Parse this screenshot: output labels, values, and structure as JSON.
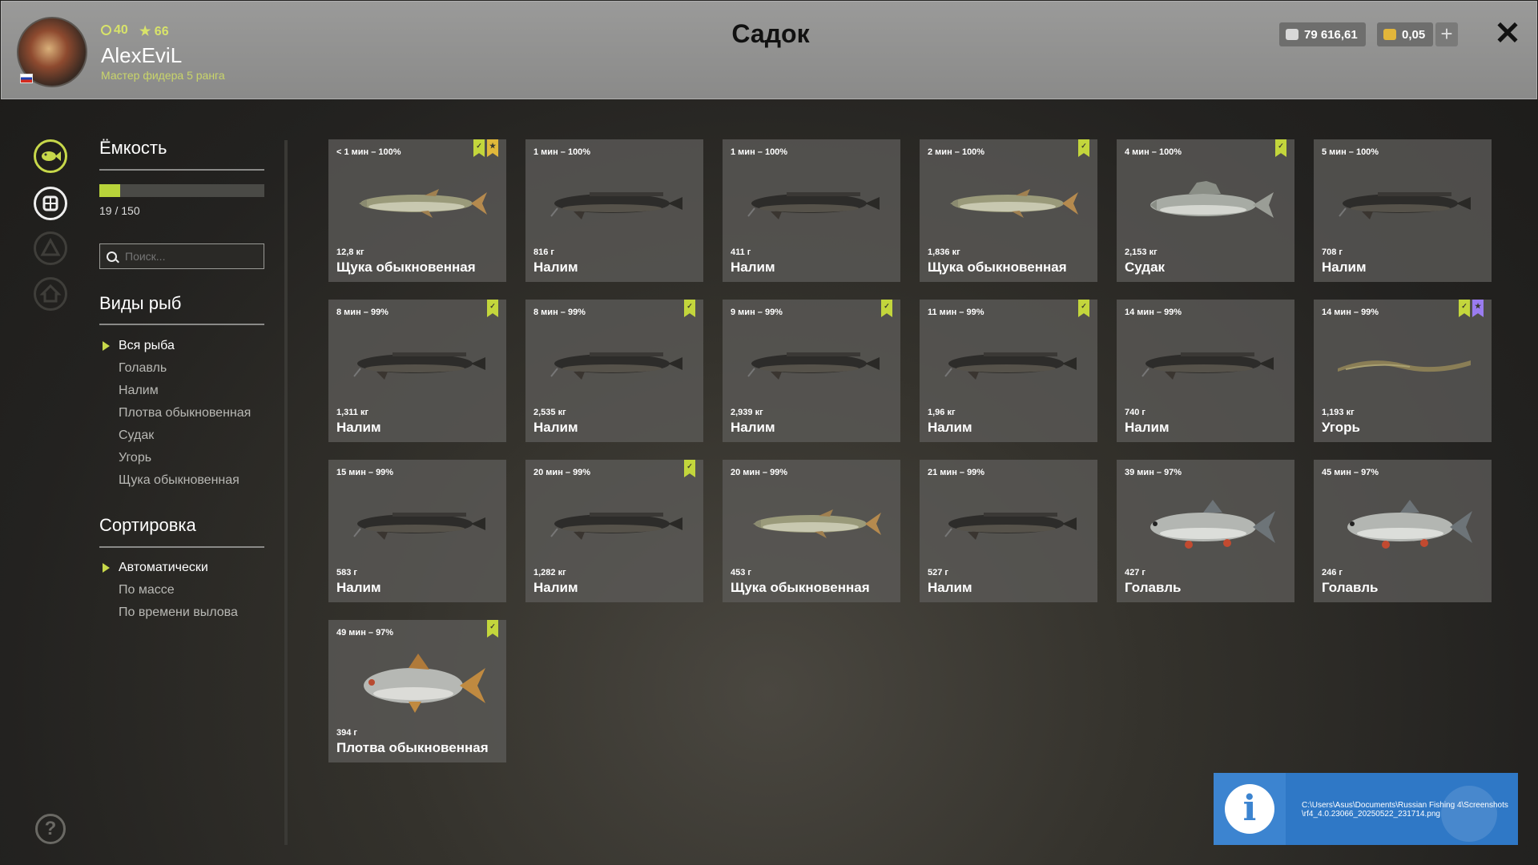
{
  "header": {
    "title": "Садок",
    "username": "AlexEviL",
    "rank": "Мастер фидера 5 ранга",
    "level": "40",
    "stars": "66",
    "silver": "79 616,61",
    "gold": "0,05"
  },
  "capacity": {
    "heading": "Ёмкость",
    "text": "19 / 150",
    "fill_fraction": 0.127
  },
  "search": {
    "placeholder": "Поиск..."
  },
  "species": {
    "heading": "Виды рыб",
    "items": [
      "Вся рыба",
      "Голавль",
      "Налим",
      "Плотва обыкновенная",
      "Судак",
      "Угорь",
      "Щука обыкновенная"
    ],
    "selected": 0
  },
  "sort": {
    "heading": "Сортировка",
    "items": [
      "Автоматически",
      "По массе",
      "По времени вылова"
    ],
    "selected": 0
  },
  "fish": [
    {
      "time": "< 1 мин – 100%",
      "weight": "12,8 кг",
      "name": "Щука обыкновенная",
      "kind": "pike",
      "badges": [
        "green",
        "gold"
      ]
    },
    {
      "time": "1 мин – 100%",
      "weight": "816 г",
      "name": "Налим",
      "kind": "burbot",
      "badges": []
    },
    {
      "time": "1 мин – 100%",
      "weight": "411 г",
      "name": "Налим",
      "kind": "burbot",
      "badges": []
    },
    {
      "time": "2 мин – 100%",
      "weight": "1,836 кг",
      "name": "Щука обыкновенная",
      "kind": "pike",
      "badges": [
        "green"
      ]
    },
    {
      "time": "4 мин – 100%",
      "weight": "2,153 кг",
      "name": "Судак",
      "kind": "zander",
      "badges": [
        "green"
      ]
    },
    {
      "time": "5 мин – 100%",
      "weight": "708 г",
      "name": "Налим",
      "kind": "burbot",
      "badges": []
    },
    {
      "time": "8 мин – 99%",
      "weight": "1,311 кг",
      "name": "Налим",
      "kind": "burbot",
      "badges": [
        "green"
      ]
    },
    {
      "time": "8 мин – 99%",
      "weight": "2,535 кг",
      "name": "Налим",
      "kind": "burbot",
      "badges": [
        "green"
      ]
    },
    {
      "time": "9 мин – 99%",
      "weight": "2,939 кг",
      "name": "Налим",
      "kind": "burbot",
      "badges": [
        "green"
      ]
    },
    {
      "time": "11 мин – 99%",
      "weight": "1,96 кг",
      "name": "Налим",
      "kind": "burbot",
      "badges": [
        "green"
      ]
    },
    {
      "time": "14 мин – 99%",
      "weight": "740 г",
      "name": "Налим",
      "kind": "burbot",
      "badges": []
    },
    {
      "time": "14 мин – 99%",
      "weight": "1,193 кг",
      "name": "Угорь",
      "kind": "eel",
      "badges": [
        "green",
        "purple"
      ]
    },
    {
      "time": "15 мин – 99%",
      "weight": "583 г",
      "name": "Налим",
      "kind": "burbot",
      "badges": []
    },
    {
      "time": "20 мин – 99%",
      "weight": "1,282 кг",
      "name": "Налим",
      "kind": "burbot",
      "badges": [
        "green"
      ]
    },
    {
      "time": "20 мин – 99%",
      "weight": "453 г",
      "name": "Щука обыкновенная",
      "kind": "pike",
      "badges": []
    },
    {
      "time": "21 мин – 99%",
      "weight": "527 г",
      "name": "Налим",
      "kind": "burbot",
      "badges": []
    },
    {
      "time": "39 мин – 97%",
      "weight": "427 г",
      "name": "Голавль",
      "kind": "chub",
      "badges": []
    },
    {
      "time": "45 мин – 97%",
      "weight": "246 г",
      "name": "Голавль",
      "kind": "chub",
      "badges": []
    },
    {
      "time": "49 мин – 97%",
      "weight": "394 г",
      "name": "Плотва обыкновенная",
      "kind": "roach",
      "badges": [
        "green"
      ]
    }
  ],
  "notification": {
    "icon": "info-icon",
    "text": "C:\\Users\\Asus\\Documents\\Russian Fishing 4\\Screenshots\\rf4_4.0.23066_20250522_231714.png"
  },
  "colors": {
    "accent": "#c7d84a",
    "bookmark_green": "#c3d63c",
    "bookmark_gold": "#e0b83a",
    "bookmark_purple": "#9a7cf0",
    "notification": "#2f78c6"
  }
}
